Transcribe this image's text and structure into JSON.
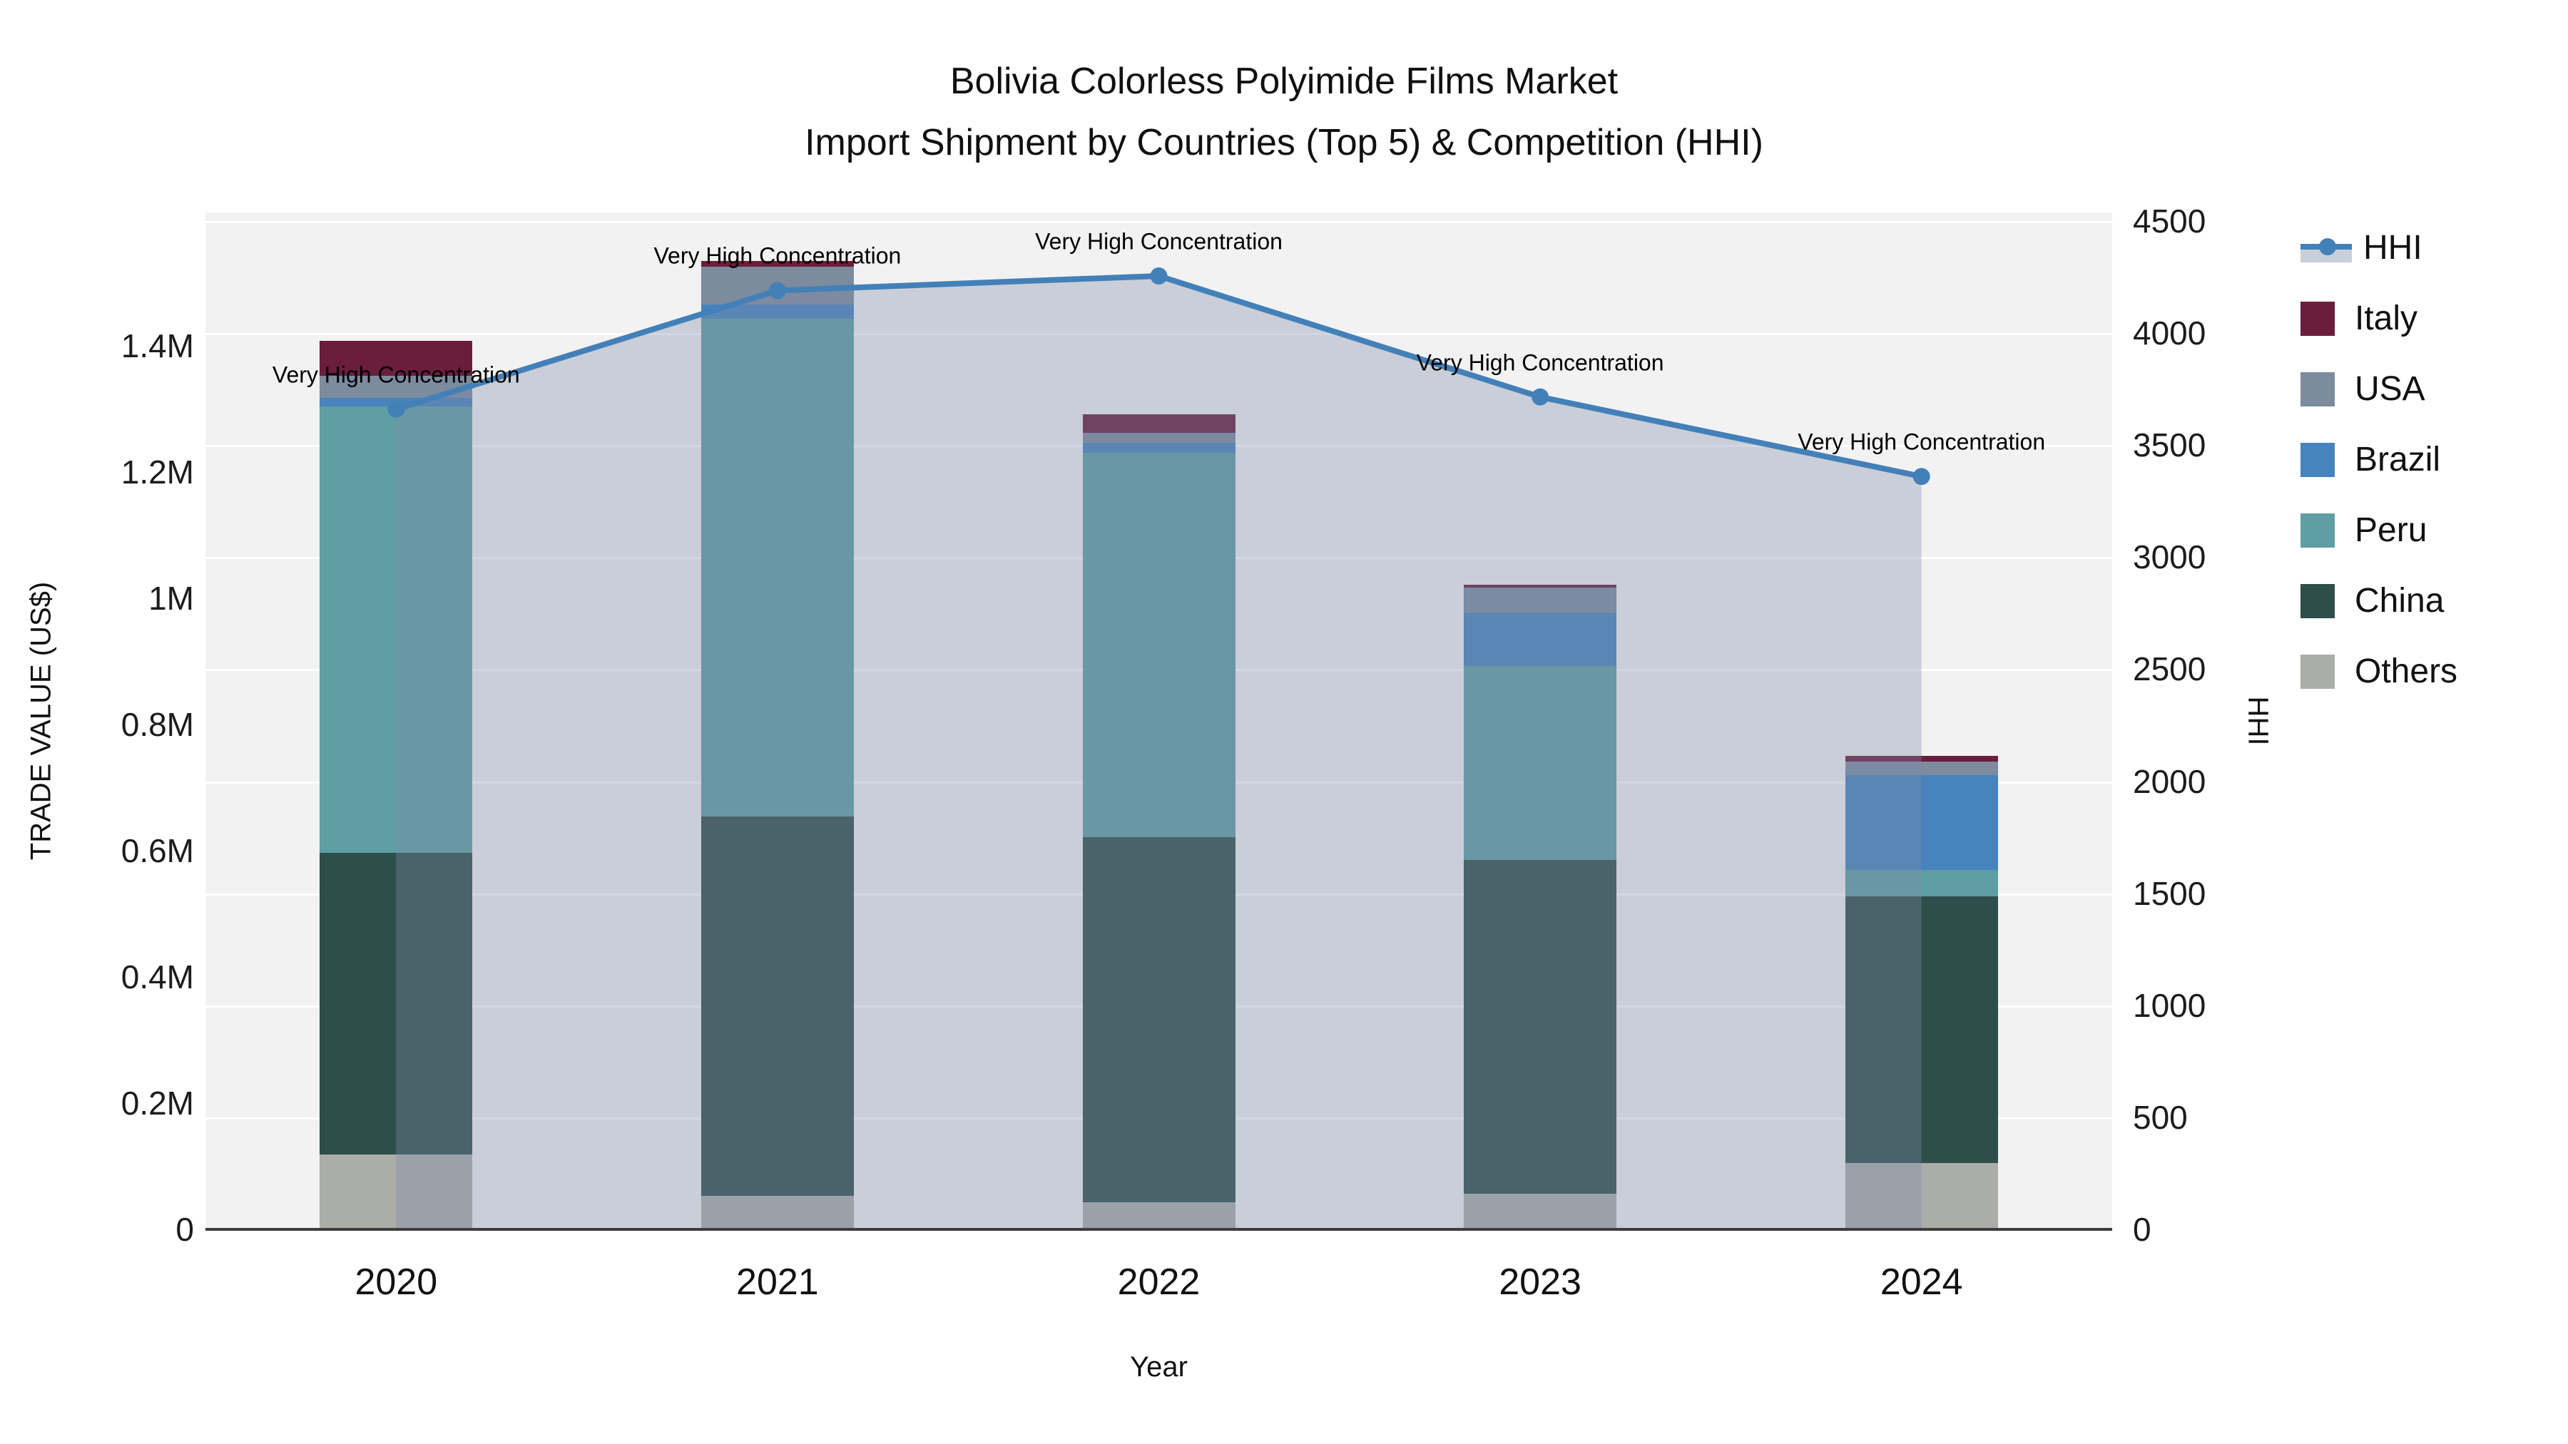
{
  "title": {
    "line1": "Bolivia Colorless Polyimide Films Market",
    "line2": "Import Shipment by Countries (Top 5) & Competition (HHI)"
  },
  "axes": {
    "x_title": "Year",
    "y_left_title": "TRADE VALUE (US$)",
    "y_right_title": "HHI",
    "y_left_ticks": [
      {
        "label": "0",
        "value": 0
      },
      {
        "label": "0.2M",
        "value": 200000
      },
      {
        "label": "0.4M",
        "value": 400000
      },
      {
        "label": "0.6M",
        "value": 600000
      },
      {
        "label": "0.8M",
        "value": 800000
      },
      {
        "label": "1M",
        "value": 1000000
      },
      {
        "label": "1.2M",
        "value": 1200000
      },
      {
        "label": "1.4M",
        "value": 1400000
      }
    ],
    "y_right_ticks": [
      {
        "label": "0",
        "value": 0
      },
      {
        "label": "500",
        "value": 500
      },
      {
        "label": "1000",
        "value": 1000
      },
      {
        "label": "1500",
        "value": 1500
      },
      {
        "label": "2000",
        "value": 2000
      },
      {
        "label": "2500",
        "value": 2500
      },
      {
        "label": "3000",
        "value": 3000
      },
      {
        "label": "3500",
        "value": 3500
      },
      {
        "label": "4000",
        "value": 4000
      },
      {
        "label": "4500",
        "value": 4500
      }
    ]
  },
  "legend": {
    "items": [
      {
        "label": "HHI",
        "type": "line",
        "color": "#4380B8"
      },
      {
        "label": "Italy",
        "type": "swatch",
        "color": "#6B1D3C"
      },
      {
        "label": "USA",
        "type": "swatch",
        "color": "#7C8B9E"
      },
      {
        "label": "Brazil",
        "type": "swatch",
        "color": "#4783BD"
      },
      {
        "label": "Peru",
        "type": "swatch",
        "color": "#5F9EA2"
      },
      {
        "label": "China",
        "type": "swatch",
        "color": "#2E4E4B"
      },
      {
        "label": "Others",
        "type": "swatch",
        "color": "#ABADA9"
      }
    ]
  },
  "colors": {
    "plot_background": "#f2f2f2",
    "gridline": "#ffffff",
    "axis_line": "#3d3d3d",
    "hhi_line": "#4380B8",
    "hhi_area_fill": "rgba(126,140,170,0.35)"
  },
  "chart_data": [
    {
      "type": "bar",
      "stacked": true,
      "title": "Bolivia Colorless Polyimide Films Market — Import Shipment by Countries (Top 5) & Competition (HHI)",
      "xlabel": "Year",
      "ylabel": "TRADE VALUE (US$)",
      "ylim": [
        0,
        1612000
      ],
      "categories": [
        "2020",
        "2021",
        "2022",
        "2023",
        "2024"
      ],
      "series": [
        {
          "name": "Others",
          "color": "#ABADA9",
          "values": [
            119000,
            53000,
            43000,
            57000,
            105000
          ]
        },
        {
          "name": "China",
          "color": "#2E4E4B",
          "values": [
            478000,
            601000,
            579000,
            528000,
            423000
          ]
        },
        {
          "name": "Peru",
          "color": "#5F9EA2",
          "values": [
            707000,
            789000,
            608000,
            308000,
            42000
          ]
        },
        {
          "name": "Brazil",
          "color": "#4783BD",
          "values": [
            14000,
            23000,
            16000,
            84000,
            150000
          ]
        },
        {
          "name": "USA",
          "color": "#7C8B9E",
          "values": [
            35000,
            59000,
            16000,
            40000,
            21000
          ]
        },
        {
          "name": "Italy",
          "color": "#6B1D3C",
          "values": [
            55000,
            10000,
            29000,
            5000,
            9000
          ]
        }
      ],
      "totals": [
        1408000,
        1535000,
        1291000,
        1022000,
        750000
      ]
    },
    {
      "type": "line",
      "name": "HHI",
      "area_fill": true,
      "x": [
        "2020",
        "2021",
        "2022",
        "2023",
        "2024"
      ],
      "values": [
        3660,
        4190,
        4255,
        3715,
        3360
      ],
      "ylabel": "HHI",
      "ylim": [
        0,
        4538
      ],
      "legend_position": "right",
      "grid": true,
      "annotations": [
        {
          "x": "2020",
          "text": "Very High Concentration"
        },
        {
          "x": "2021",
          "text": "Very High Concentration"
        },
        {
          "x": "2022",
          "text": "Very High Concentration"
        },
        {
          "x": "2023",
          "text": "Very High Concentration"
        },
        {
          "x": "2024",
          "text": "Very High Concentration"
        }
      ]
    }
  ]
}
